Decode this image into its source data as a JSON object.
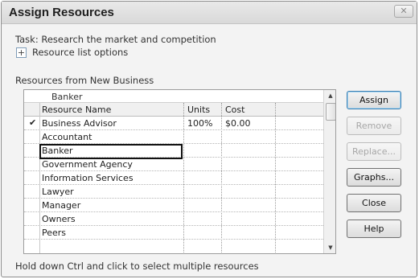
{
  "dialog": {
    "title": "Assign Resources",
    "close_glyph": "✕"
  },
  "task_label": "Task: Research the market and competition",
  "options": {
    "expand_glyph": "+",
    "label": "Resource list options"
  },
  "resources_label": "Resources from New Business",
  "grid": {
    "entry_value": "Banker",
    "headers": {
      "name": "Resource Name",
      "units": "Units",
      "cost": "Cost"
    },
    "rows": [
      {
        "check": "✔",
        "name": "Business Advisor",
        "units": "100%",
        "cost": "$0.00"
      },
      {
        "check": "",
        "name": "Accountant",
        "units": "",
        "cost": ""
      },
      {
        "check": "",
        "name": "Banker",
        "units": "",
        "cost": ""
      },
      {
        "check": "",
        "name": "Government Agency",
        "units": "",
        "cost": ""
      },
      {
        "check": "",
        "name": "Information Services",
        "units": "",
        "cost": ""
      },
      {
        "check": "",
        "name": "Lawyer",
        "units": "",
        "cost": ""
      },
      {
        "check": "",
        "name": "Manager",
        "units": "",
        "cost": ""
      },
      {
        "check": "",
        "name": "Owners",
        "units": "",
        "cost": ""
      },
      {
        "check": "",
        "name": "Peers",
        "units": "",
        "cost": ""
      }
    ],
    "scroll_up_glyph": "▲",
    "scroll_down_glyph": "▼"
  },
  "buttons": {
    "assign": "Assign",
    "remove": "Remove",
    "replace": "Replace...",
    "graphs": "Graphs...",
    "close": "Close",
    "help": "Help"
  },
  "hint": "Hold down Ctrl and click to select multiple resources"
}
